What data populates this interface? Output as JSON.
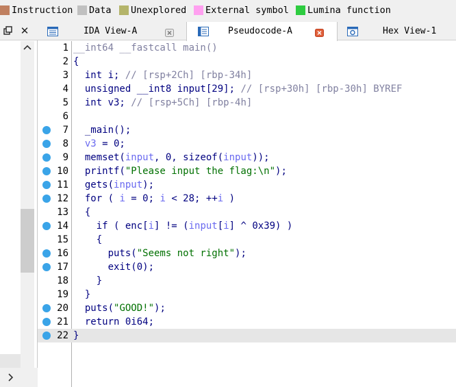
{
  "legend": [
    {
      "label": "Instruction",
      "color": "#c08060"
    },
    {
      "label": "Data",
      "color": "#c0c0c0"
    },
    {
      "label": "Unexplored",
      "color": "#b4b46a"
    },
    {
      "label": "External symbol",
      "color": "#ffa0f0"
    },
    {
      "label": "Lumina function",
      "color": "#2ecc40"
    }
  ],
  "tabs": [
    {
      "label": "IDA View-A",
      "icon": "graph-icon",
      "active": false
    },
    {
      "label": "Pseudocode-A",
      "icon": "pseudocode-icon",
      "active": true
    },
    {
      "label": "Hex View-1",
      "icon": "hex-icon",
      "active": false
    }
  ],
  "editor": {
    "current_line": 22,
    "lines": [
      {
        "n": "1",
        "bp": false,
        "t": "__int64 __fastcall main()"
      },
      {
        "n": "2",
        "bp": false,
        "t": "{"
      },
      {
        "n": "3",
        "bp": false,
        "t": "  int i; // [rsp+2Ch] [rbp-34h]"
      },
      {
        "n": "4",
        "bp": false,
        "t": "  unsigned __int8 input[29]; // [rsp+30h] [rbp-30h] BYREF"
      },
      {
        "n": "5",
        "bp": false,
        "t": "  int v3; // [rsp+5Ch] [rbp-4h]"
      },
      {
        "n": "6",
        "bp": false,
        "t": ""
      },
      {
        "n": "7",
        "bp": true,
        "t": "  _main();"
      },
      {
        "n": "8",
        "bp": true,
        "t": "  v3 = 0;"
      },
      {
        "n": "9",
        "bp": true,
        "t": "  memset(input, 0, sizeof(input));"
      },
      {
        "n": "10",
        "bp": true,
        "t": "  printf(\"Please input the flag:\\n\");"
      },
      {
        "n": "11",
        "bp": true,
        "t": "  gets(input);"
      },
      {
        "n": "12",
        "bp": true,
        "t": "  for ( i = 0; i < 28; ++i )"
      },
      {
        "n": "13",
        "bp": false,
        "t": "  {"
      },
      {
        "n": "14",
        "bp": true,
        "t": "    if ( enc[i] != (input[i] ^ 0x39) )"
      },
      {
        "n": "15",
        "bp": false,
        "t": "    {"
      },
      {
        "n": "16",
        "bp": true,
        "t": "      puts(\"Seems not right\");"
      },
      {
        "n": "17",
        "bp": true,
        "t": "      exit(0);"
      },
      {
        "n": "18",
        "bp": false,
        "t": "    }"
      },
      {
        "n": "19",
        "bp": false,
        "t": "  }"
      },
      {
        "n": "20",
        "bp": true,
        "t": "  puts(\"GOOD!\");"
      },
      {
        "n": "21",
        "bp": true,
        "t": "  return 0i64;"
      },
      {
        "n": "22",
        "bp": true,
        "t": "}"
      }
    ]
  },
  "colors": {
    "breakpoint_dot": "#3aa4e8",
    "keyword": "#000080",
    "comment": "#8080a0",
    "string": "#007000",
    "variable": "#6a6af0"
  }
}
